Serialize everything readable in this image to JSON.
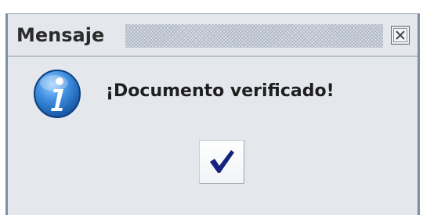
{
  "dialog": {
    "title": "Mensaje",
    "message": "¡Documento verificado!",
    "icons": {
      "info": "information-icon",
      "close": "close-icon",
      "confirm": "checkmark-icon"
    },
    "colors": {
      "accent": "#2a5ca8",
      "checkmark": "#13247a",
      "background": "#e4e7eb"
    }
  }
}
